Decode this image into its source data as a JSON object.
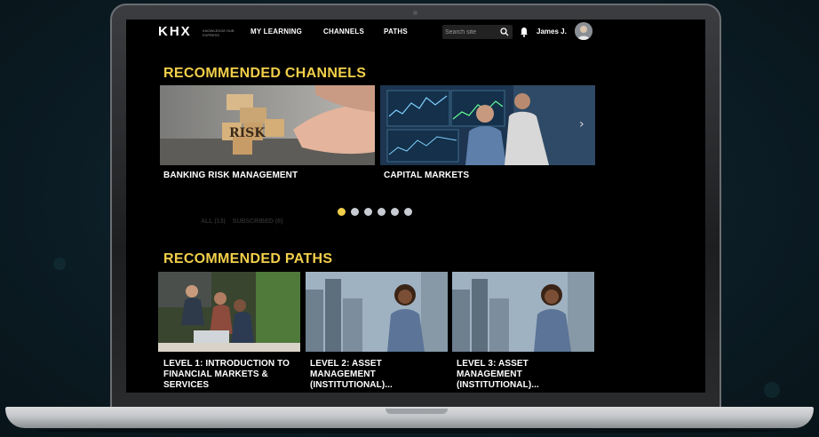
{
  "header": {
    "logo": "KHX",
    "logo_sub": "KNOWLEDGE HUB EXPRESS",
    "nav": [
      {
        "label": "MY LEARNING"
      },
      {
        "label": "CHANNELS"
      },
      {
        "label": "PATHS"
      }
    ],
    "search": {
      "placeholder": "Search site"
    },
    "user": {
      "name": "James J."
    }
  },
  "recommended_channels": {
    "title": "RECOMMENDED CHANNELS",
    "cards": [
      {
        "label": "BANKING RISK MANAGEMENT",
        "image_text": "RISK"
      },
      {
        "label": "CAPITAL MARKETS"
      }
    ],
    "dots_count": 6,
    "active_dot": 0
  },
  "tabs_faded": {
    "all": "ALL (13)",
    "subscribed": "SUBSCRIBED (6)"
  },
  "recommended_paths": {
    "title": "RECOMMENDED PATHS",
    "cards": [
      {
        "label": "LEVEL 1: INTRODUCTION TO FINANCIAL MARKETS & SERVICES"
      },
      {
        "label": "LEVEL 2: ASSET MANAGEMENT (INSTITUTIONAL)..."
      },
      {
        "label": "LEVEL 3: ASSET MANAGEMENT (INSTITUTIONAL)..."
      }
    ]
  },
  "colors": {
    "accent": "#f2cf4a",
    "background": "#000000"
  }
}
